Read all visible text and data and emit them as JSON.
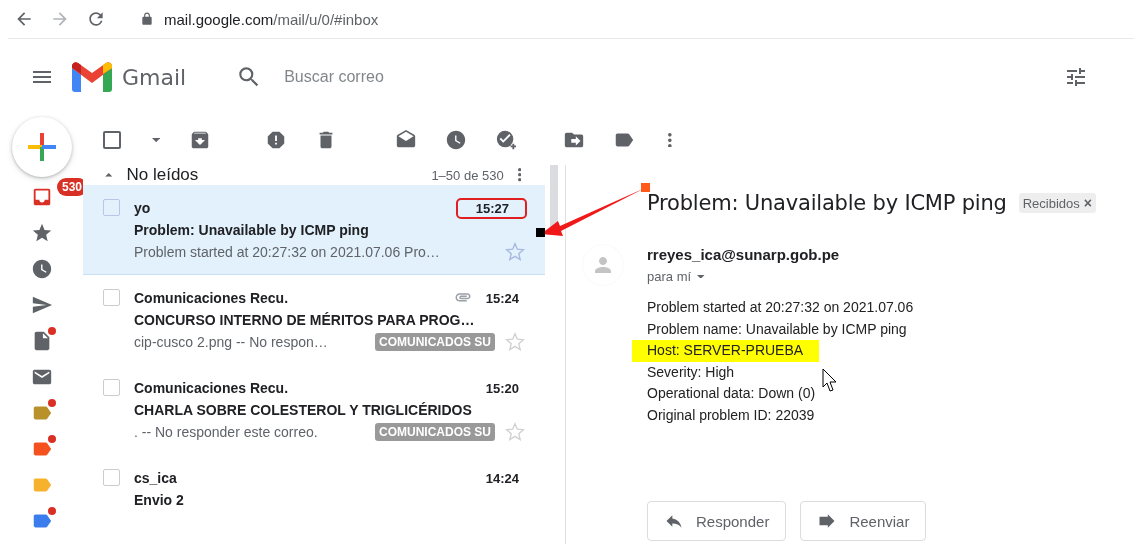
{
  "browser": {
    "url_host": "mail.google.com",
    "url_path": "/mail/u/0/#inbox"
  },
  "header": {
    "app_name": "Gmail",
    "search_placeholder": "Buscar correo"
  },
  "rail": [
    {
      "kind": "inbox",
      "badge": "530"
    },
    {
      "kind": "starred"
    },
    {
      "kind": "snoozed"
    },
    {
      "kind": "sent"
    },
    {
      "kind": "drafts",
      "dot": true
    },
    {
      "kind": "mail"
    },
    {
      "kind": "label",
      "color": "#b8912b",
      "dot": true
    },
    {
      "kind": "label",
      "color": "#f4511e",
      "dot": true
    },
    {
      "kind": "label",
      "color": "#f6b22d",
      "dot": false
    },
    {
      "kind": "label",
      "color": "#3b7ded",
      "dot": true
    }
  ],
  "toolbar": {
    "select_all_checked": false
  },
  "list": {
    "section_title": "No leídos",
    "range": "1–50 de 530",
    "emails": [
      {
        "sender": "yo",
        "subject": "Problem: Unavailable by ICMP ping",
        "snippet": "Problem started at 20:27:32 on 2021.07.06 Pro…",
        "time": "15:27",
        "selected": true,
        "unread": true,
        "attachment": false,
        "time_circled": true
      },
      {
        "sender": "Comunicaciones Recu.",
        "subject": "CONCURSO INTERNO DE MÉRITOS PARA PROG…",
        "snippet": "cip-cusco 2.png -- No respon…",
        "tag": "COMUNICADOS SU",
        "time": "15:24",
        "selected": false,
        "unread": true,
        "attachment": true,
        "time_circled": false
      },
      {
        "sender": "Comunicaciones Recu.",
        "subject": "CHARLA SOBRE COLESTEROL Y TRIGLICÉRIDOS",
        "snippet": ". -- No responder este correo.",
        "tag": "COMUNICADOS SU",
        "time": "15:20",
        "selected": false,
        "unread": true,
        "attachment": false,
        "time_circled": false
      },
      {
        "sender": "cs_ica",
        "subject": "Envio 2",
        "time": "14:24",
        "selected": false,
        "unread": true,
        "attachment": false,
        "time_circled": false
      }
    ]
  },
  "reader": {
    "subject": "Problem: Unavailable by ICMP ping",
    "label": "Recibidos",
    "label_close": "×",
    "from": "rreyes_ica@sunarp.gob.pe",
    "to": "para mí",
    "body": [
      {
        "text": "Problem started at 20:27:32 on 2021.07.06",
        "highlighted": false
      },
      {
        "text": "Problem name: Unavailable by ICMP ping",
        "highlighted": false
      },
      {
        "text": "Host: SERVER-PRUEBA",
        "highlighted": true
      },
      {
        "text": "Severity: High",
        "highlighted": false
      },
      {
        "text": "Operational data: Down (0)",
        "highlighted": false
      },
      {
        "text": "Original problem ID: 22039",
        "highlighted": false
      }
    ],
    "buttons": [
      {
        "kind": "reply",
        "label": "Responder"
      },
      {
        "kind": "forward",
        "label": "Reenviar"
      }
    ]
  }
}
